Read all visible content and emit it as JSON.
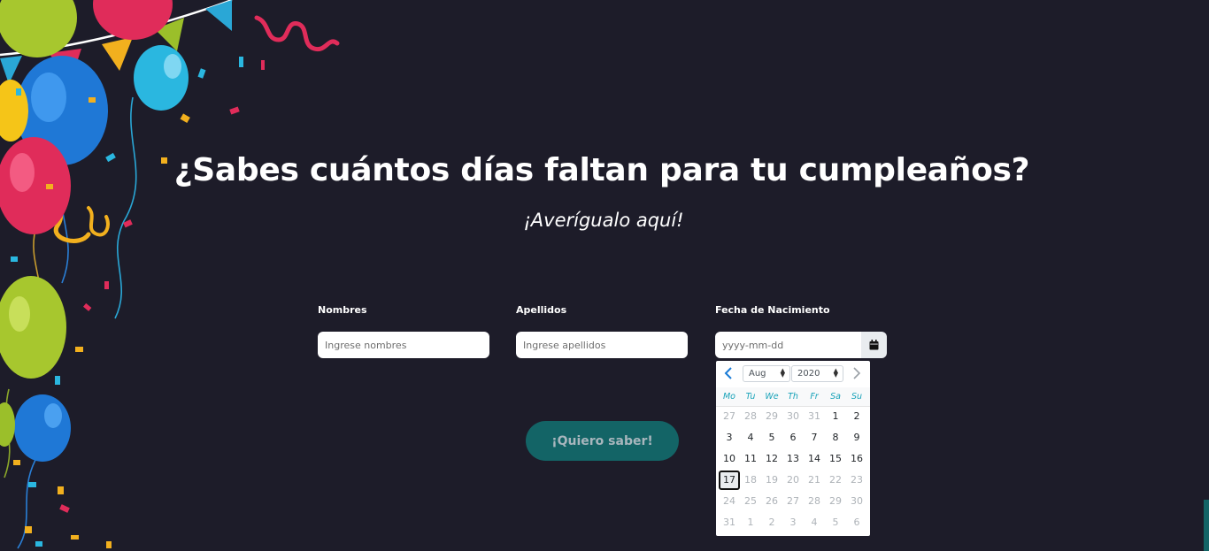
{
  "hero": {
    "title": "¿Sabes cuántos días faltan para tu cumpleaños?",
    "subtitle": "¡Averígualo aquí!"
  },
  "form": {
    "first_name": {
      "label": "Nombres",
      "placeholder": "Ingrese nombres",
      "value": ""
    },
    "last_name": {
      "label": "Apellidos",
      "placeholder": "Ingrese apellidos",
      "value": ""
    },
    "birth_date": {
      "label": "Fecha de Nacimiento",
      "placeholder": "yyyy-mm-dd",
      "value": "",
      "icon": "calendar-icon"
    },
    "submit_label": "¡Quiero saber!"
  },
  "datepicker": {
    "month": "Aug",
    "year": "2020",
    "prev_icon": "chevron-left-icon",
    "next_icon": "chevron-right-icon",
    "weekdays": [
      "Mo",
      "Tu",
      "We",
      "Th",
      "Fr",
      "Sa",
      "Su"
    ],
    "weeks": [
      [
        {
          "d": "27",
          "m": true
        },
        {
          "d": "28",
          "m": true
        },
        {
          "d": "29",
          "m": true
        },
        {
          "d": "30",
          "m": true
        },
        {
          "d": "31",
          "m": true
        },
        {
          "d": "1",
          "m": false
        },
        {
          "d": "2",
          "m": false
        }
      ],
      [
        {
          "d": "3",
          "m": false
        },
        {
          "d": "4",
          "m": false
        },
        {
          "d": "5",
          "m": false
        },
        {
          "d": "6",
          "m": false
        },
        {
          "d": "7",
          "m": false
        },
        {
          "d": "8",
          "m": false
        },
        {
          "d": "9",
          "m": false
        }
      ],
      [
        {
          "d": "10",
          "m": false
        },
        {
          "d": "11",
          "m": false
        },
        {
          "d": "12",
          "m": false
        },
        {
          "d": "13",
          "m": false
        },
        {
          "d": "14",
          "m": false
        },
        {
          "d": "15",
          "m": false
        },
        {
          "d": "16",
          "m": false
        }
      ],
      [
        {
          "d": "17",
          "m": false,
          "active": true
        },
        {
          "d": "18",
          "m": true
        },
        {
          "d": "19",
          "m": true
        },
        {
          "d": "20",
          "m": true
        },
        {
          "d": "21",
          "m": true
        },
        {
          "d": "22",
          "m": true
        },
        {
          "d": "23",
          "m": true
        }
      ],
      [
        {
          "d": "24",
          "m": true
        },
        {
          "d": "25",
          "m": true
        },
        {
          "d": "26",
          "m": true
        },
        {
          "d": "27",
          "m": true
        },
        {
          "d": "28",
          "m": true
        },
        {
          "d": "29",
          "m": true
        },
        {
          "d": "30",
          "m": true
        }
      ],
      [
        {
          "d": "31",
          "m": true
        },
        {
          "d": "1",
          "m": true
        },
        {
          "d": "2",
          "m": true
        },
        {
          "d": "3",
          "m": true
        },
        {
          "d": "4",
          "m": true
        },
        {
          "d": "5",
          "m": true
        },
        {
          "d": "6",
          "m": true
        }
      ]
    ]
  },
  "colors": {
    "background": "#1d1c29",
    "button": "#136466",
    "button_text": "#a8b6bd",
    "weekday_text": "#17a2b8",
    "nav_active": "#1a7bd6"
  },
  "decoration": {
    "icon": "balloons-confetti-decoration"
  }
}
